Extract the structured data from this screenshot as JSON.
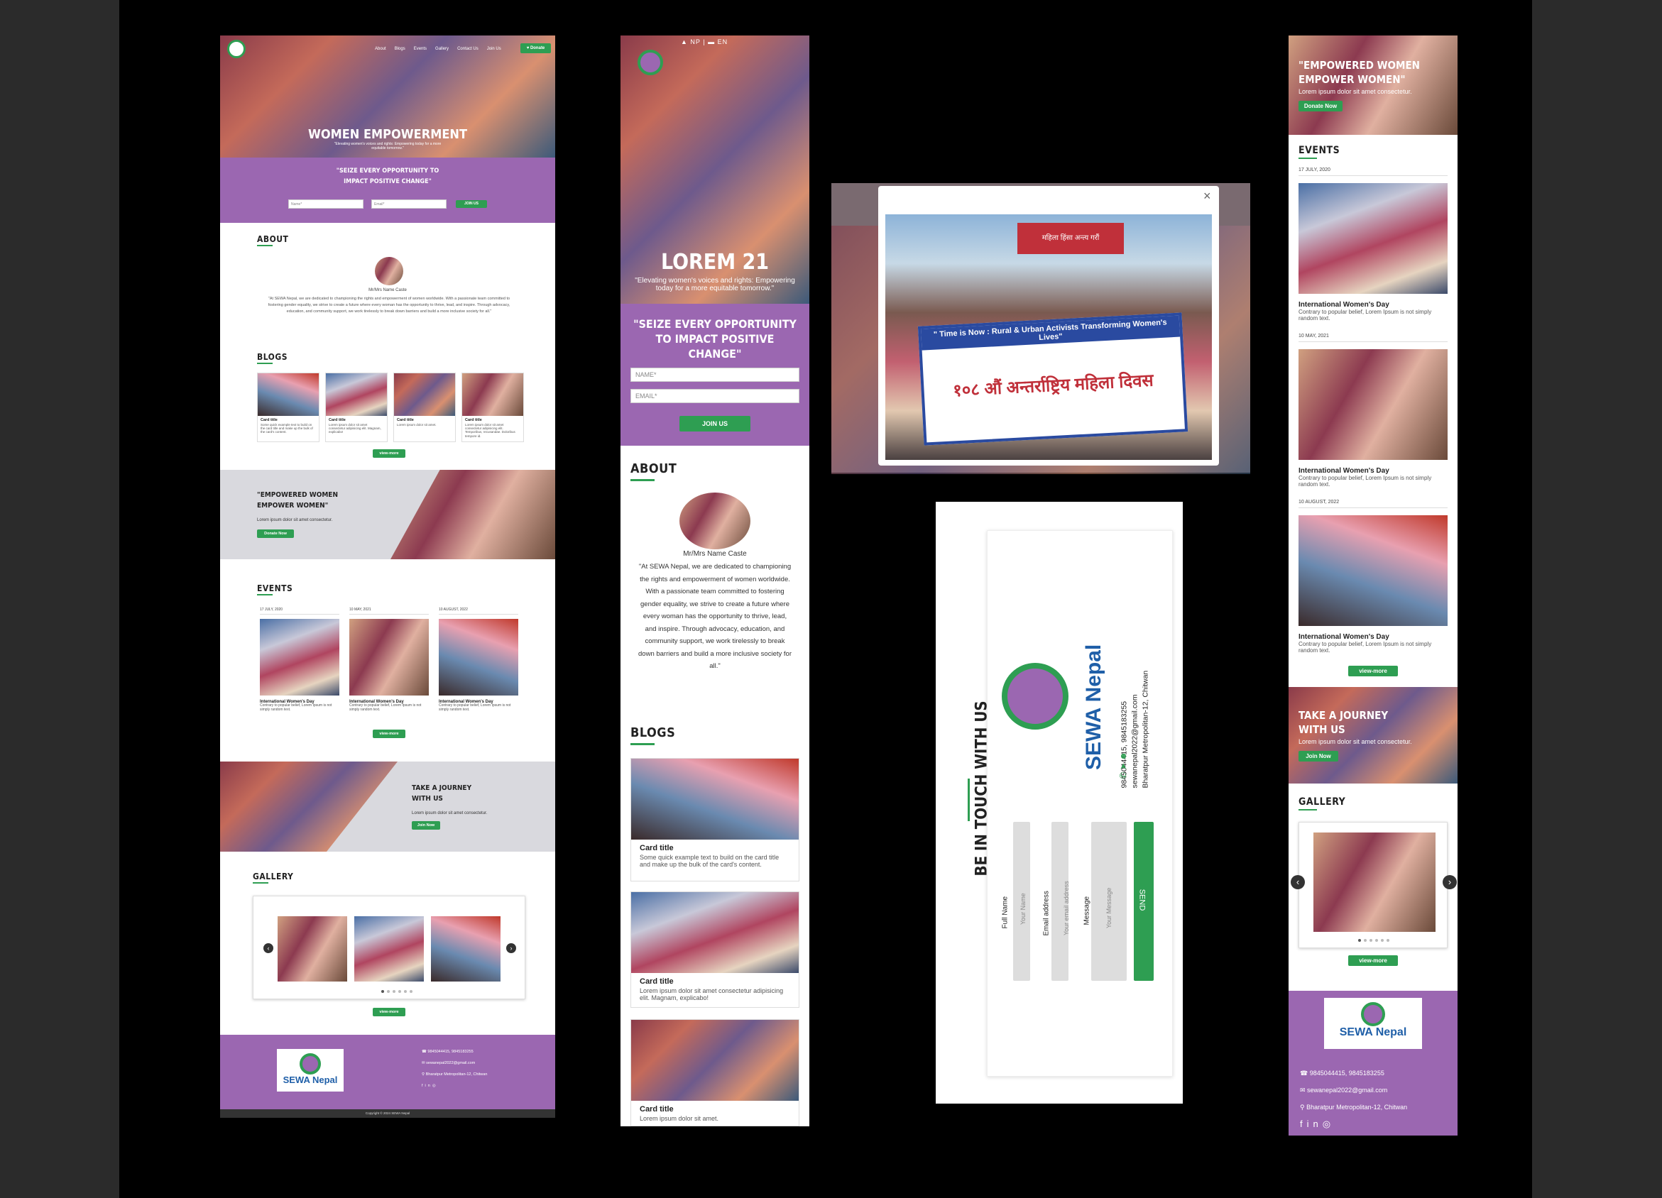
{
  "desktop": {
    "nav": [
      "About",
      "Blogs",
      "Events",
      "Gallery",
      "Contact Us",
      "Join Us"
    ],
    "donate": "Donate",
    "hero_title": "WOMEN EMPOWERMENT",
    "hero_sub": "\"Elevating women's voices and rights: Empowering today for a more equitable tomorrow.\"",
    "quote": "\"SEIZE EVERY OPPORTUNITY TO IMPACT POSITIVE CHANGE\"",
    "name_ph": "Name*",
    "email_ph": "Email*",
    "join": "JOIN US",
    "about_h": "ABOUT",
    "person": "Mr/Mrs Name Caste",
    "about_text": "\"At SEWA Nepal, we are dedicated to championing the rights and empowerment of women worldwide. With a passionate team committed to fostering gender equality, we strive to create a future where every woman has the opportunity to thrive, lead, and inspire. Through advocacy, education, and community support, we work tirelessly to break down barriers and build a more inclusive society for all.\"",
    "blogs_h": "BLOGS",
    "blog_cards": [
      {
        "title": "Card title",
        "text": "Some quick example text to build on the card title and make up the bulk of the card's content."
      },
      {
        "title": "Card title",
        "text": "Lorem ipsum dolor sit amet consectetur adipisicing elit. Magnam, explicabo!"
      },
      {
        "title": "Card title",
        "text": "Lorem ipsum dolor sit amet."
      },
      {
        "title": "Card title",
        "text": "Lorem ipsum dolor sit amet consectetur adipisicing elit. Temporibus, recusandae. Doloribus tempore id."
      }
    ],
    "view_more": "view-more",
    "banner1_title": "\"EMPOWERED WOMEN EMPOWER WOMEN\"",
    "banner1_text": "Lorem ipsum dolor sit amet consectetur.",
    "donate_now": "Donate Now",
    "events_h": "EVENTS",
    "events": [
      {
        "date": "17 JULY, 2020",
        "title": "International Women's Day",
        "text": "Contrary to popular belief, Lorem Ipsum is not simply random text."
      },
      {
        "date": "10 MAY, 2021",
        "title": "International Women's Day",
        "text": "Contrary to popular belief, Lorem Ipsum is not simply random text."
      },
      {
        "date": "10 AUGUST, 2022",
        "title": "International Women's Day",
        "text": "Contrary to popular belief, Lorem Ipsum is not simply random text."
      }
    ],
    "banner2_title": "TAKE A JOURNEY WITH US",
    "banner2_text": "Lorem ipsum dolor sit amet consectetur.",
    "join_now": "Join Now",
    "gallery_h": "GALLERY",
    "logo": "SEWA Nepal",
    "phone": "9845044415, 9845183255",
    "email": "sewanepal2022@gmail.com",
    "address": "Bharatpur Metropolitan-12, Chitwan",
    "copyright": "Copyright © 2024 SEWA Nepal"
  },
  "mobile": {
    "lang_np": "NP",
    "lang_en": "EN",
    "hero_title": "LOREM 21",
    "hero_sub": "\"Elevating women's voices and rights: Empowering today for a more equitable tomorrow.\"",
    "quote": "\"SEIZE EVERY OPPORTUNITY TO IMPACT POSITIVE CHANGE\"",
    "name_ph": "NAME*",
    "email_ph": "EMAIL*",
    "join": "JOIN US",
    "about_h": "ABOUT",
    "person": "Mr/Mrs Name Caste",
    "about_text": "\"At SEWA Nepal, we are dedicated to championing the rights and empowerment of women worldwide. With a passionate team committed to fostering gender equality, we strive to create a future where every woman has the opportunity to thrive, lead, and inspire. Through advocacy, education, and community support, we work tirelessly to break down barriers and build a more inclusive society for all.\"",
    "blogs_h": "BLOGS",
    "blog_cards": [
      {
        "title": "Card title",
        "text": "Some quick example text to build on the card title and make up the bulk of the card's content."
      },
      {
        "title": "Card title",
        "text": "Lorem ipsum dolor sit amet consectetur adipisicing elit. Magnam, explicabo!"
      },
      {
        "title": "Card title",
        "text": "Lorem ipsum dolor sit amet."
      }
    ]
  },
  "modal": {
    "close": "×",
    "banner_en": "\" Time is Now : Rural & Urban Activists Transforming Women's Lives\"",
    "banner_np": "१०८ औं अन्तर्राष्ट्रिय महिला दिवस",
    "banner_top": "महिला हिंसा अन्त्य गरौं"
  },
  "contact": {
    "heading": "BE IN TOUCH WITH US",
    "logo": "SEWA Nepal",
    "phone": "9845044415, 9845183255",
    "email": "sewanepal2022@gmail.com",
    "address": "Bharatpur Metropolitan-12, Chitwan",
    "fields": [
      {
        "label": "Full Name",
        "placeholder": "Your Name"
      },
      {
        "label": "Email address",
        "placeholder": "Your email address"
      },
      {
        "label": "Message",
        "placeholder": "Your Message"
      }
    ],
    "send": "SEND"
  },
  "right": {
    "hero_title": "\"EMPOWERED WOMEN EMPOWER WOMEN\"",
    "hero_text": "Lorem ipsum dolor sit amet consectetur.",
    "donate_now": "Donate Now",
    "events_h": "EVENTS",
    "events": [
      {
        "date": "17 JULY, 2020",
        "title": "International Women's Day",
        "text": "Contrary to popular belief, Lorem Ipsum is not simply random text."
      },
      {
        "date": "10 MAY, 2021",
        "title": "International Women's Day",
        "text": "Contrary to popular belief, Lorem Ipsum is not simply random text."
      },
      {
        "date": "10 AUGUST, 2022",
        "title": "International Women's Day",
        "text": "Contrary to popular belief, Lorem Ipsum is not simply random text."
      }
    ],
    "view_more": "view-more",
    "journey_title": "TAKE A JOURNEY WITH US",
    "journey_text": "Lorem ipsum dolor sit amet consectetur.",
    "join_now": "Join Now",
    "gallery_h": "GALLERY",
    "logo": "SEWA Nepal",
    "phone": "9845044415, 9845183255",
    "email": "sewanepal2022@gmail.com",
    "address": "Bharatpur Metropolitan-12, Chitwan"
  }
}
